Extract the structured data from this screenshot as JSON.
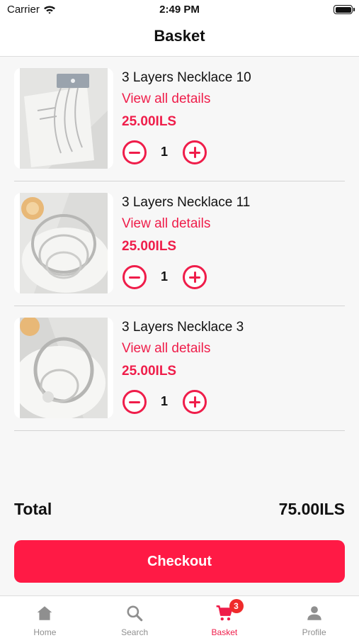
{
  "status_bar": {
    "carrier": "Carrier",
    "time": "2:49 PM"
  },
  "header": {
    "title": "Basket"
  },
  "items": [
    {
      "name": "3 Layers Necklace 10",
      "link": "View all details",
      "price": "25.00ILS",
      "quantity": "1"
    },
    {
      "name": "3 Layers Necklace 11",
      "link": "View all details",
      "price": "25.00ILS",
      "quantity": "1"
    },
    {
      "name": "3 Layers Necklace 3",
      "link": "View all details",
      "price": "25.00ILS",
      "quantity": "1"
    }
  ],
  "summary": {
    "total_label": "Total",
    "total_value": "75.00ILS"
  },
  "checkout_label": "Checkout",
  "tabs": [
    {
      "label": "Home",
      "icon": "home-icon"
    },
    {
      "label": "Search",
      "icon": "search-icon"
    },
    {
      "label": "Basket",
      "icon": "cart-icon",
      "badge": "3"
    },
    {
      "label": "Profile",
      "icon": "person-icon"
    }
  ],
  "colors": {
    "accent": "#ef1d4a",
    "checkout": "#ff1a45",
    "badge": "#ef2b2b",
    "inactive_tab": "#8f8f8f"
  }
}
